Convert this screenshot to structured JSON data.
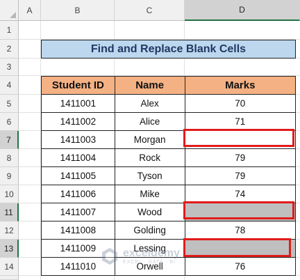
{
  "columns": [
    "A",
    "B",
    "C",
    "D"
  ],
  "selected_column": "D",
  "rows": [
    "1",
    "2",
    "3",
    "4",
    "5",
    "6",
    "7",
    "8",
    "9",
    "10",
    "11",
    "12",
    "13",
    "14"
  ],
  "selected_rows": [
    "7",
    "11",
    "13"
  ],
  "title": "Find and Replace Blank Cells",
  "table": {
    "headers": [
      "Student ID",
      "Name",
      "Marks"
    ],
    "rows": [
      {
        "id": "1411001",
        "name": "Alex",
        "marks": "70"
      },
      {
        "id": "1411002",
        "name": "Alice",
        "marks": "71"
      },
      {
        "id": "1411003",
        "name": "Morgan",
        "marks": ""
      },
      {
        "id": "1411004",
        "name": "Rock",
        "marks": "79"
      },
      {
        "id": "1411005",
        "name": "Tyson",
        "marks": "79"
      },
      {
        "id": "1411006",
        "name": "Mike",
        "marks": "74"
      },
      {
        "id": "1411007",
        "name": "Wood",
        "marks": ""
      },
      {
        "id": "1411008",
        "name": "Golding",
        "marks": "78"
      },
      {
        "id": "1411009",
        "name": "Lessing",
        "marks": ""
      },
      {
        "id": "1411010",
        "name": "Orwell",
        "marks": "76"
      }
    ]
  },
  "watermark": {
    "name": "exceldemy",
    "tagline": "EXCEL · DATA · BI"
  },
  "colors": {
    "title_fill": "#bdd7ee",
    "header_fill": "#f4b183",
    "blank_fill": "#bfbfbf",
    "highlight": "#e21b1b"
  }
}
